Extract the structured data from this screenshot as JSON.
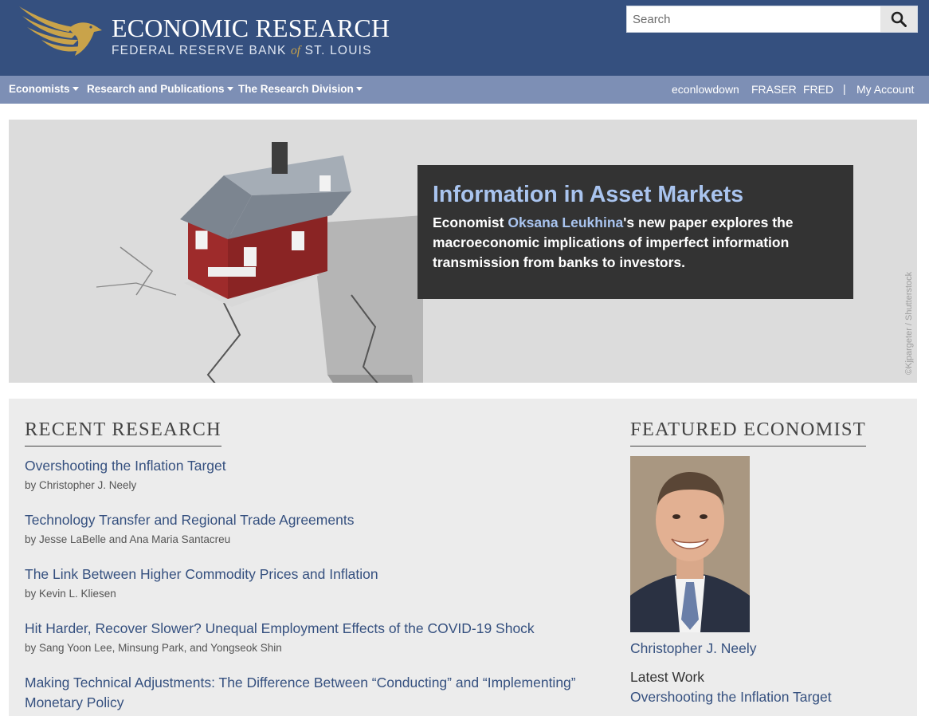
{
  "header": {
    "title": "ECONOMIC RESEARCH",
    "subtitle_pre": "FEDERAL RESERVE BANK ",
    "subtitle_of": "of",
    "subtitle_post": " ST. LOUIS",
    "logo_icon": "eagle-icon",
    "search_placeholder": "Search",
    "search_icon": "search-icon"
  },
  "nav": {
    "left": [
      {
        "label": "Economists",
        "icon": "caret-down-icon"
      },
      {
        "label": "Research and Publications",
        "icon": "caret-down-icon"
      },
      {
        "label": "The Research Division",
        "icon": "caret-down-icon"
      }
    ],
    "right": [
      {
        "label": "econlowdown"
      },
      {
        "label": "FRASER"
      },
      {
        "label": "FRED"
      }
    ],
    "separator": "|",
    "account": "My Account"
  },
  "hero": {
    "title": "Information in Asset Markets",
    "desc_pre": "Economist ",
    "desc_link": "Oksana Leukhina",
    "desc_post": "'s new paper explores the macroeconomic implications of imperfect information transmission from banks to investors.",
    "credit": "©Kjpargeter / Shutterstock"
  },
  "recent": {
    "heading": "RECENT RESEARCH",
    "articles": [
      {
        "title": "Overshooting the Inflation Target",
        "by": "by Christopher J. Neely"
      },
      {
        "title": "Technology Transfer and Regional Trade Agreements",
        "by": "by Jesse LaBelle and Ana Maria Santacreu"
      },
      {
        "title": "The Link Between Higher Commodity Prices and Inflation",
        "by": "by Kevin L. Kliesen"
      },
      {
        "title": "Hit Harder, Recover Slower? Unequal Employment Effects of the COVID-19 Shock",
        "by": "by Sang Yoon Lee, Minsung Park, and Yongseok Shin"
      },
      {
        "title": "Making Technical Adjustments: The Difference Between “Conducting” and “Implementing” Monetary Policy",
        "by": ""
      }
    ]
  },
  "featured": {
    "heading": "FEATURED ECONOMIST",
    "name": "Christopher J. Neely",
    "latest_label": "Latest Work",
    "latest_title": "Overshooting the Inflation Target"
  },
  "colors": {
    "header_bg": "#35507f",
    "nav_bg": "#7d8fb5",
    "accent_gold": "#c9a34a",
    "link": "#35507f",
    "hero_highlight": "#a9c4ef",
    "hero_card_bg": "#333333"
  }
}
